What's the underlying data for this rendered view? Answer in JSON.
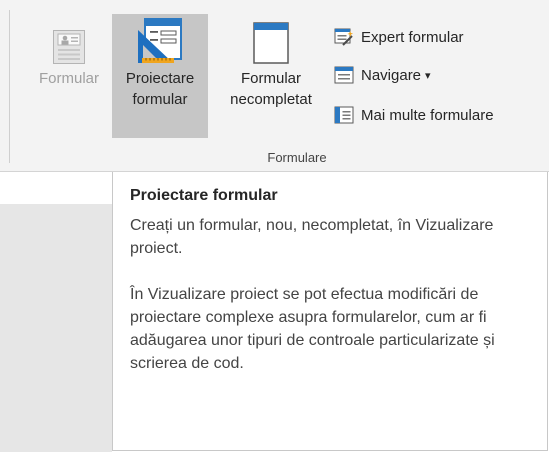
{
  "ribbon": {
    "buttons_large": [
      {
        "line1": "Formular",
        "line2": "",
        "icon": "form-icon",
        "state": "disabled"
      },
      {
        "line1": "Proiectare",
        "line2": "formular",
        "icon": "form-design-icon",
        "state": "selected"
      },
      {
        "line1": "Formular",
        "line2": "necompletat",
        "icon": "blank-form-icon",
        "state": "normal"
      }
    ],
    "buttons_small": [
      {
        "label": "Expert formular",
        "icon": "form-wizard-icon"
      },
      {
        "label": "Navigare",
        "icon": "navigation-icon",
        "has_dropdown": true,
        "dropdown_glyph": "▾"
      },
      {
        "label": "Mai multe formulare",
        "icon": "more-forms-icon"
      }
    ],
    "group_label": "Formulare"
  },
  "tooltip": {
    "title": "Proiectare formular",
    "paragraphs": [
      "Creați un formular, nou, necompletat, în Vizualizare proiect.",
      "În Vizualizare proiect se pot efectua modificări de proiectare complexe asupra formularelor, cum ar fi adăugarea unor tipuri de controale particularizate și scrierea de cod."
    ]
  },
  "colors": {
    "ribbon_bg": "#f3f3f3",
    "selected_bg": "#c6c6c6",
    "accent_blue": "#2b79c2",
    "disabled_text": "#a0a0a0"
  }
}
